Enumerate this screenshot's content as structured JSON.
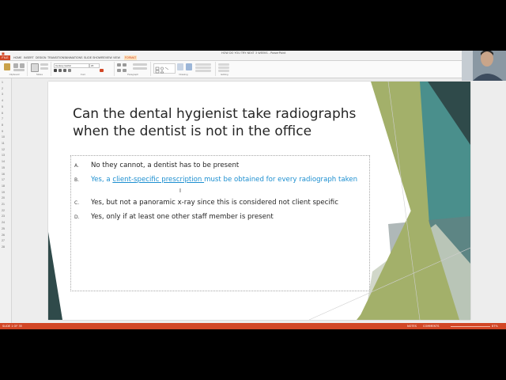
{
  "window": {
    "title": "HOW DO YOU TRY NEXT 3 WEEKS - PowerPoint"
  },
  "ribbon": {
    "file_label": "FILE",
    "tabs": [
      "HOME",
      "INSERT",
      "DESIGN",
      "TRANSITIONS",
      "ANIMATIONS",
      "SLIDE SHOW",
      "REVIEW",
      "VIEW"
    ],
    "format_tab": "FORMAT",
    "groups": [
      "Clipboard",
      "Slides",
      "Font",
      "Paragraph",
      "Drawing",
      "Editing"
    ],
    "font_name": "Century Gothic",
    "font_size": "20"
  },
  "thumbs": {
    "numbers": [
      "1",
      "2",
      "3",
      "4",
      "5",
      "6",
      "7",
      "8",
      "9",
      "10",
      "11",
      "12",
      "13",
      "14",
      "15",
      "16",
      "17",
      "18",
      "19",
      "20",
      "21",
      "22",
      "23",
      "24",
      "25",
      "26",
      "27",
      "28"
    ]
  },
  "slide": {
    "title": "Can the dental hygienist take radiographs when the dentist is not in the office",
    "options": [
      {
        "letter": "A.",
        "text": "No they cannot, a dentist has to be present"
      },
      {
        "letter": "B.",
        "pre": "Yes, a ",
        "link": "client-specific prescription ",
        "post": "must be obtained for every radiograph taken"
      },
      {
        "letter": "C.",
        "text": "Yes, but not a panoramic x-ray since this is considered not client specific"
      },
      {
        "letter": "D.",
        "text": "Yes, only if at least one other staff member is present"
      }
    ]
  },
  "status": {
    "left": "SLIDE 1 OF 35",
    "notes": "NOTES",
    "comments": "COMMENTS",
    "zoom": "87%"
  },
  "colors": {
    "accent": "#d24726",
    "link_blue": "#1d8fd0",
    "olive": "#a3b06a",
    "dark_teal": "#2f4a4a",
    "teal": "#4a8f8c"
  }
}
